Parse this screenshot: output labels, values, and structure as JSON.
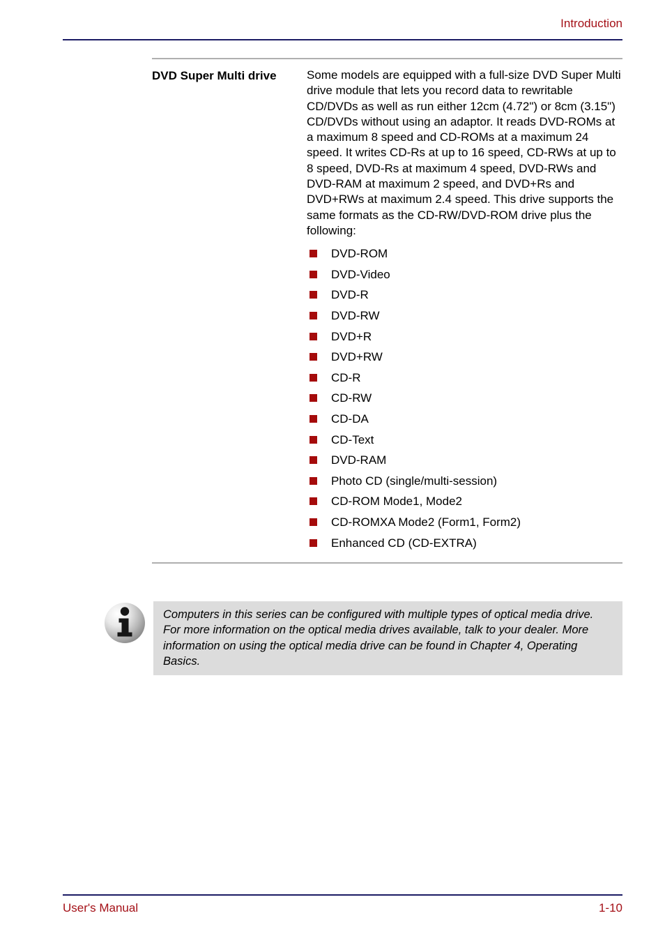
{
  "header": {
    "title": "Introduction",
    "rule_color": "#1B1B64"
  },
  "content": {
    "rule_color": "#AFAFAF",
    "spec": {
      "label": "DVD Super Multi drive",
      "body": "Some models are equipped with a full-size DVD Super Multi drive module that lets you record data to rewritable CD/DVDs as well as run either 12cm (4.72\") or 8cm (3.15\") CD/DVDs without using an adaptor. It reads DVD-ROMs at a maximum 8 speed and CD-ROMs at a maximum 24 speed. It writes CD-Rs at up to 16 speed, CD-RWs at up to 8 speed, DVD-Rs at maximum 4 speed, DVD-RWs and DVD-RAM at maximum 2 speed, and DVD+Rs and DVD+RWs at maximum 2.4 speed. This drive supports the same formats as the CD-RW/DVD-ROM drive plus the following:",
      "bullet_color": "#A50B0B",
      "formats": [
        "DVD-ROM",
        "DVD-Video",
        "DVD-R",
        "DVD-RW",
        "DVD+R",
        "DVD+RW",
        "CD-R",
        "CD-RW",
        "CD-DA",
        "CD-Text",
        "DVD-RAM",
        "Photo CD (single/multi-session)",
        "CD-ROM Mode1, Mode2",
        "CD-ROMXA Mode2 (Form1, Form2)",
        "Enhanced CD (CD-EXTRA)"
      ]
    }
  },
  "note": {
    "icon": "info-icon",
    "background": "#DCDCDC",
    "text": "Computers in this series can be configured with multiple types of optical media drive. For more information on the optical media drives available, talk to your dealer. More information on using the optical media drive can be found in Chapter 4, Operating Basics."
  },
  "footer": {
    "left": "User's Manual",
    "right": "1-10",
    "text_color": "#A41017",
    "rule_color": "#1B1B64"
  }
}
